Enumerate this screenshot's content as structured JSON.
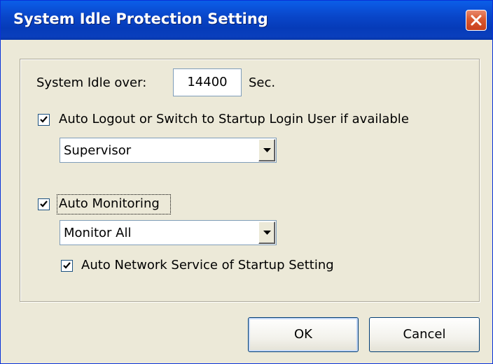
{
  "window": {
    "title": "System Idle Protection Setting"
  },
  "idle": {
    "label": "System Idle over:",
    "value": "14400",
    "unit": "Sec."
  },
  "auto_logout": {
    "checked": true,
    "label": "Auto Logout or Switch to Startup Login User if available",
    "select_value": "Supervisor"
  },
  "auto_monitoring": {
    "checked": true,
    "label": "Auto Monitoring",
    "select_value": "Monitor All",
    "network_service": {
      "checked": true,
      "label": "Auto Network Service of Startup Setting"
    }
  },
  "buttons": {
    "ok": "OK",
    "cancel": "Cancel"
  },
  "colors": {
    "titlebar": "#0946c9",
    "dialog_bg": "#ece9d8",
    "close_button": "#d9582f",
    "button_border": "#003c74"
  }
}
